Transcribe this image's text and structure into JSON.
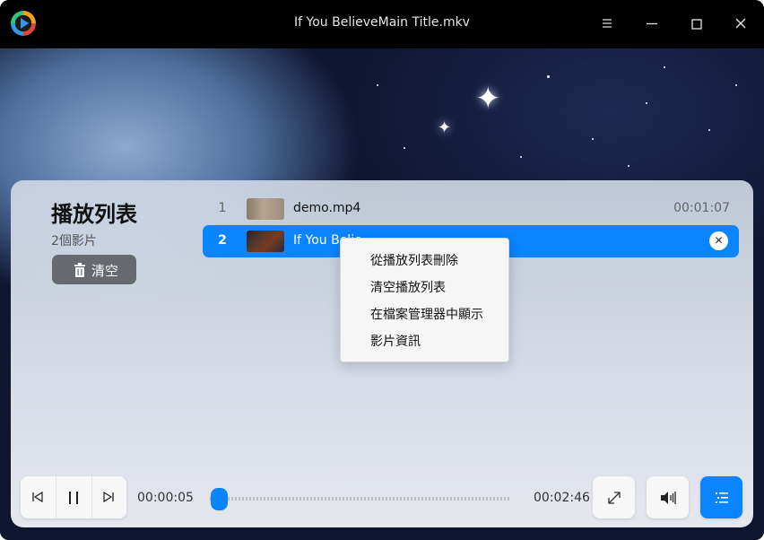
{
  "window": {
    "title": "If You BelieveMain Title.mkv"
  },
  "titlebar_icons": [
    "app-logo-icon",
    "menu-icon",
    "minimize-icon",
    "maximize-icon",
    "close-icon"
  ],
  "playlist": {
    "title": "播放列表",
    "count_label": "2個影片",
    "clear_label": "清空",
    "items": [
      {
        "index": "1",
        "name": "demo.mp4",
        "duration": "00:01:07",
        "selected": false
      },
      {
        "index": "2",
        "name": "If You Belie",
        "duration": "",
        "selected": true
      }
    ]
  },
  "context_menu": {
    "items": [
      {
        "label": "從播放列表刪除"
      },
      {
        "label": "清空播放列表"
      },
      {
        "label": "在檔案管理器中顯示"
      },
      {
        "label": "影片資訊"
      }
    ]
  },
  "controls": {
    "current_time": "00:00:05",
    "total_time": "00:02:46",
    "progress": 0.03,
    "buttons": [
      "previous-icon",
      "pause-icon",
      "next-icon",
      "fullscreen-icon",
      "volume-icon",
      "playlist-icon"
    ]
  },
  "colors": {
    "accent": "#0a84ff",
    "titlebar": "#000000",
    "clear_button": "#666a6f"
  }
}
